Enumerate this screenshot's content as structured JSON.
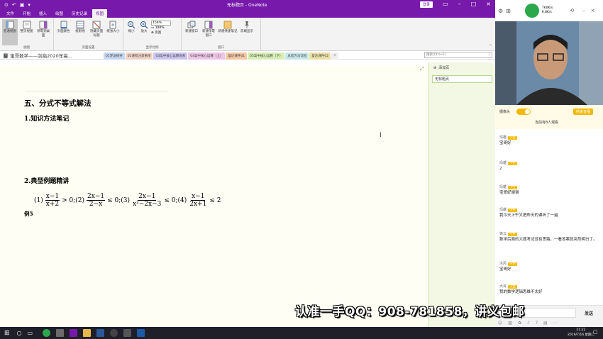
{
  "window": {
    "title": "无标题页 - OneNote",
    "login_label": "登录",
    "minimize": "–",
    "maximize": "□",
    "close": "×"
  },
  "ribbon_tabs": [
    "文件",
    "开始",
    "插入",
    "绘图",
    "历史记录",
    "视图"
  ],
  "ribbon": {
    "groups": [
      {
        "label": "视图",
        "buttons": [
          "普通视图",
          "整页视图",
          "停靠到桌面"
        ]
      },
      {
        "label": "页面设置",
        "buttons": [
          "页面颜色",
          "规则线",
          "隐藏页面标题",
          "纸张大小"
        ]
      },
      {
        "label": "显示比例",
        "buttons": [
          "缩小",
          "放大"
        ],
        "zoom_value": "156%",
        "zoom_100": "100%",
        "page_width": "页宽"
      },
      {
        "label": "窗口",
        "buttons": [
          "新建窗口",
          "新建停靠窗口",
          "新建快速笔记",
          "前端显示"
        ]
      }
    ]
  },
  "notebook": {
    "name": "宝哥数学——剑指2020年高..."
  },
  "section_tabs": [
    {
      "label": "01梦诀择导",
      "color": "#c5d7f0"
    },
    {
      "label": "02课程注意事项",
      "color": "#f0d4c5"
    },
    {
      "label": "03高中核心运算体系",
      "color": "#cbc5ef"
    },
    {
      "label": "04高中核心运算（上）",
      "color": "#eec5e6"
    },
    {
      "label": "复达课件01",
      "color": "#f4c7a4"
    },
    {
      "label": "05高中核心运算（下）",
      "color": "#d8edb5"
    },
    {
      "label": "总结方法流程",
      "color": "#c8e7e9"
    },
    {
      "label": "复达课件02",
      "color": "#ecdfa3"
    },
    {
      "label": "+",
      "color": "#eeeeee"
    }
  ],
  "search": {
    "placeholder": "搜索(Ctrl+E)"
  },
  "page_panel": {
    "add_page": "添加页",
    "pages": [
      "无标题页"
    ]
  },
  "note": {
    "heading": "五、分式不等式解法",
    "sub1": "1.知识方法笔记",
    "sub2": "2.典型例题精讲",
    "example_label": "例5"
  },
  "formula": {
    "p1": "(1)",
    "f1n": "x−1",
    "f1d": "x+2",
    "r1": "> 0;(2)",
    "f2n": "2x−1",
    "f2d": "2−x",
    "r2": "≤ 0;(3)",
    "f3n": "2x−1",
    "f3d": "x²−2x−3",
    "r3": "≤ 0;(4)",
    "f4n": "x−1",
    "f4d": "2x+1",
    "r4": "≤ 2"
  },
  "right_app": {
    "speed_up": "760K/s",
    "speed_down": "6.8K/s",
    "camera_label": "摄像头",
    "end_button": "结束直播",
    "online": "当前有8人观看",
    "send_button": "发送",
    "messages": [
      {
        "user": "玛雄",
        "badge": "学生",
        "text": "宝哥好"
      },
      {
        "user": "玛雄",
        "badge": "学生",
        "text": "2"
      },
      {
        "user": "玛雄",
        "badge": "学生",
        "text": "宝哥好谢谢"
      },
      {
        "user": "玛雄",
        "badge": "学生",
        "text": "我今天上午又把昨天的课听了一遍"
      },
      {
        "user": "锋云",
        "badge": "学生",
        "text": "数学后面的大题考试没有思路，一看答案就突然明白了。"
      },
      {
        "user": "沐风",
        "badge": "学生",
        "text": "宝哥好"
      },
      {
        "user": "大哥",
        "badge": "学生",
        "text": "我的数学逻辑思维不太好"
      }
    ]
  },
  "taskbar": {
    "time": "21:22",
    "date": "2019/7/16 星期二"
  },
  "watermark": "认准一手QQ：908-781858，讲义包邮"
}
